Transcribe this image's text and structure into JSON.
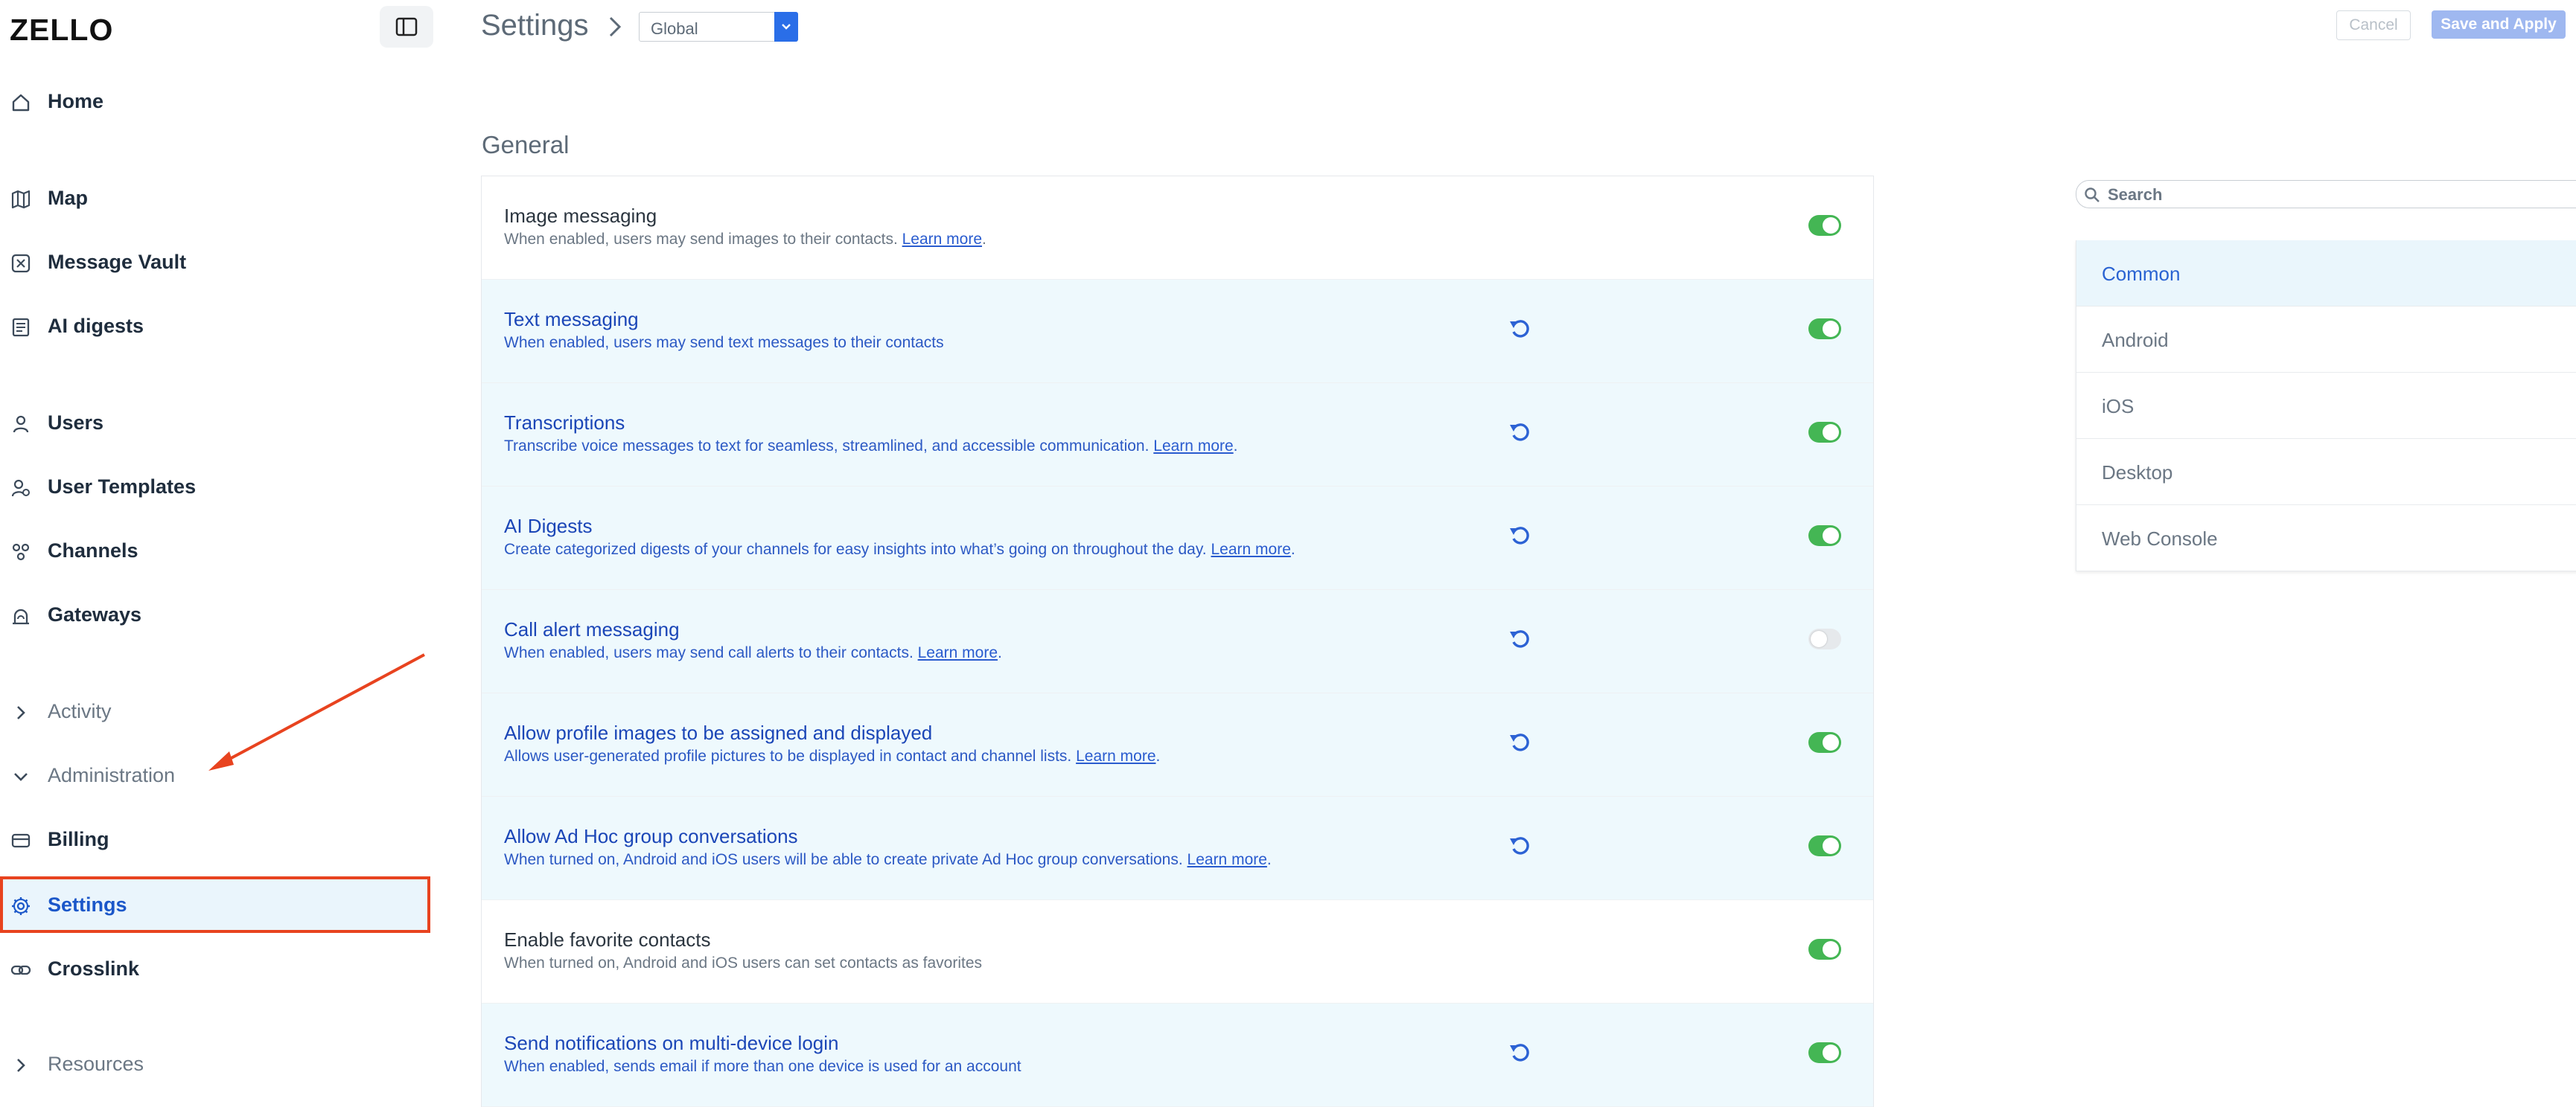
{
  "app": {
    "logo": "ZELLO"
  },
  "sidebar": {
    "items": [
      {
        "label": "Home",
        "icon": "home-icon"
      },
      {
        "label": "Map",
        "icon": "map-icon"
      },
      {
        "label": "Message Vault",
        "icon": "vault-icon"
      },
      {
        "label": "AI digests",
        "icon": "digest-icon"
      },
      {
        "label": "Users",
        "icon": "user-icon"
      },
      {
        "label": "User Templates",
        "icon": "user-template-icon"
      },
      {
        "label": "Channels",
        "icon": "channels-icon"
      },
      {
        "label": "Gateways",
        "icon": "gateway-icon"
      },
      {
        "label": "Activity",
        "icon": "chevron-right-icon"
      },
      {
        "label": "Administration",
        "icon": "chevron-down-icon"
      },
      {
        "label": "Billing",
        "icon": "billing-icon"
      },
      {
        "label": "Settings",
        "icon": "gear-icon"
      },
      {
        "label": "Crosslink",
        "icon": "link-icon"
      },
      {
        "label": "Resources",
        "icon": "chevron-right-icon"
      }
    ],
    "active_item": "Settings"
  },
  "header": {
    "title": "Settings",
    "scope": {
      "selected": "Global"
    },
    "cancel_label": "Cancel",
    "save_label": "Save and Apply"
  },
  "main": {
    "section_title": "General",
    "settings": [
      {
        "title": "Image messaging",
        "desc": "When enabled, users may send images to their contacts.",
        "link": "Learn more",
        "suffix": ".",
        "enabled": true,
        "modified": false
      },
      {
        "title": "Text messaging",
        "desc": "When enabled, users may send text messages to their contacts",
        "link": "",
        "suffix": "",
        "enabled": true,
        "modified": true
      },
      {
        "title": "Transcriptions",
        "desc": "Transcribe voice messages to text for seamless, streamlined, and accessible communication.",
        "link": "Learn more",
        "suffix": ".",
        "enabled": true,
        "modified": true
      },
      {
        "title": "AI Digests",
        "desc": "Create categorized digests of your channels for easy insights into what’s going on throughout the day.",
        "link": "Learn more",
        "suffix": ".",
        "enabled": true,
        "modified": true
      },
      {
        "title": "Call alert messaging",
        "desc": "When enabled, users may send call alerts to their contacts.",
        "link": "Learn more",
        "suffix": ".",
        "enabled": false,
        "modified": true
      },
      {
        "title": "Allow profile images to be assigned and displayed",
        "desc": "Allows user-generated profile pictures to be displayed in contact and channel lists.",
        "link": "Learn more",
        "suffix": ".",
        "enabled": true,
        "modified": true
      },
      {
        "title": "Allow Ad Hoc group conversations",
        "desc": "When turned on, Android and iOS users will be able to create private Ad Hoc group conversations.",
        "link": "Learn more",
        "suffix": ".",
        "enabled": true,
        "modified": true
      },
      {
        "title": "Enable favorite contacts",
        "desc": "When turned on, Android and iOS users can set contacts as favorites",
        "link": "",
        "suffix": "",
        "enabled": true,
        "modified": false
      },
      {
        "title": "Send notifications on multi-device login",
        "desc": "When enabled, sends email if more than one device is used for an account",
        "link": "",
        "suffix": "",
        "enabled": true,
        "modified": true
      }
    ]
  },
  "right_panel": {
    "search": {
      "placeholder": "Search",
      "value": ""
    },
    "categories": [
      "Common",
      "Android",
      "iOS",
      "Desktop",
      "Web Console"
    ],
    "active_category": "Common"
  },
  "colors": {
    "accent": "#2a63d2",
    "toggle_on": "#44b654",
    "highlight_border": "#e8431f",
    "modified_row_bg": "#eef9fd"
  }
}
